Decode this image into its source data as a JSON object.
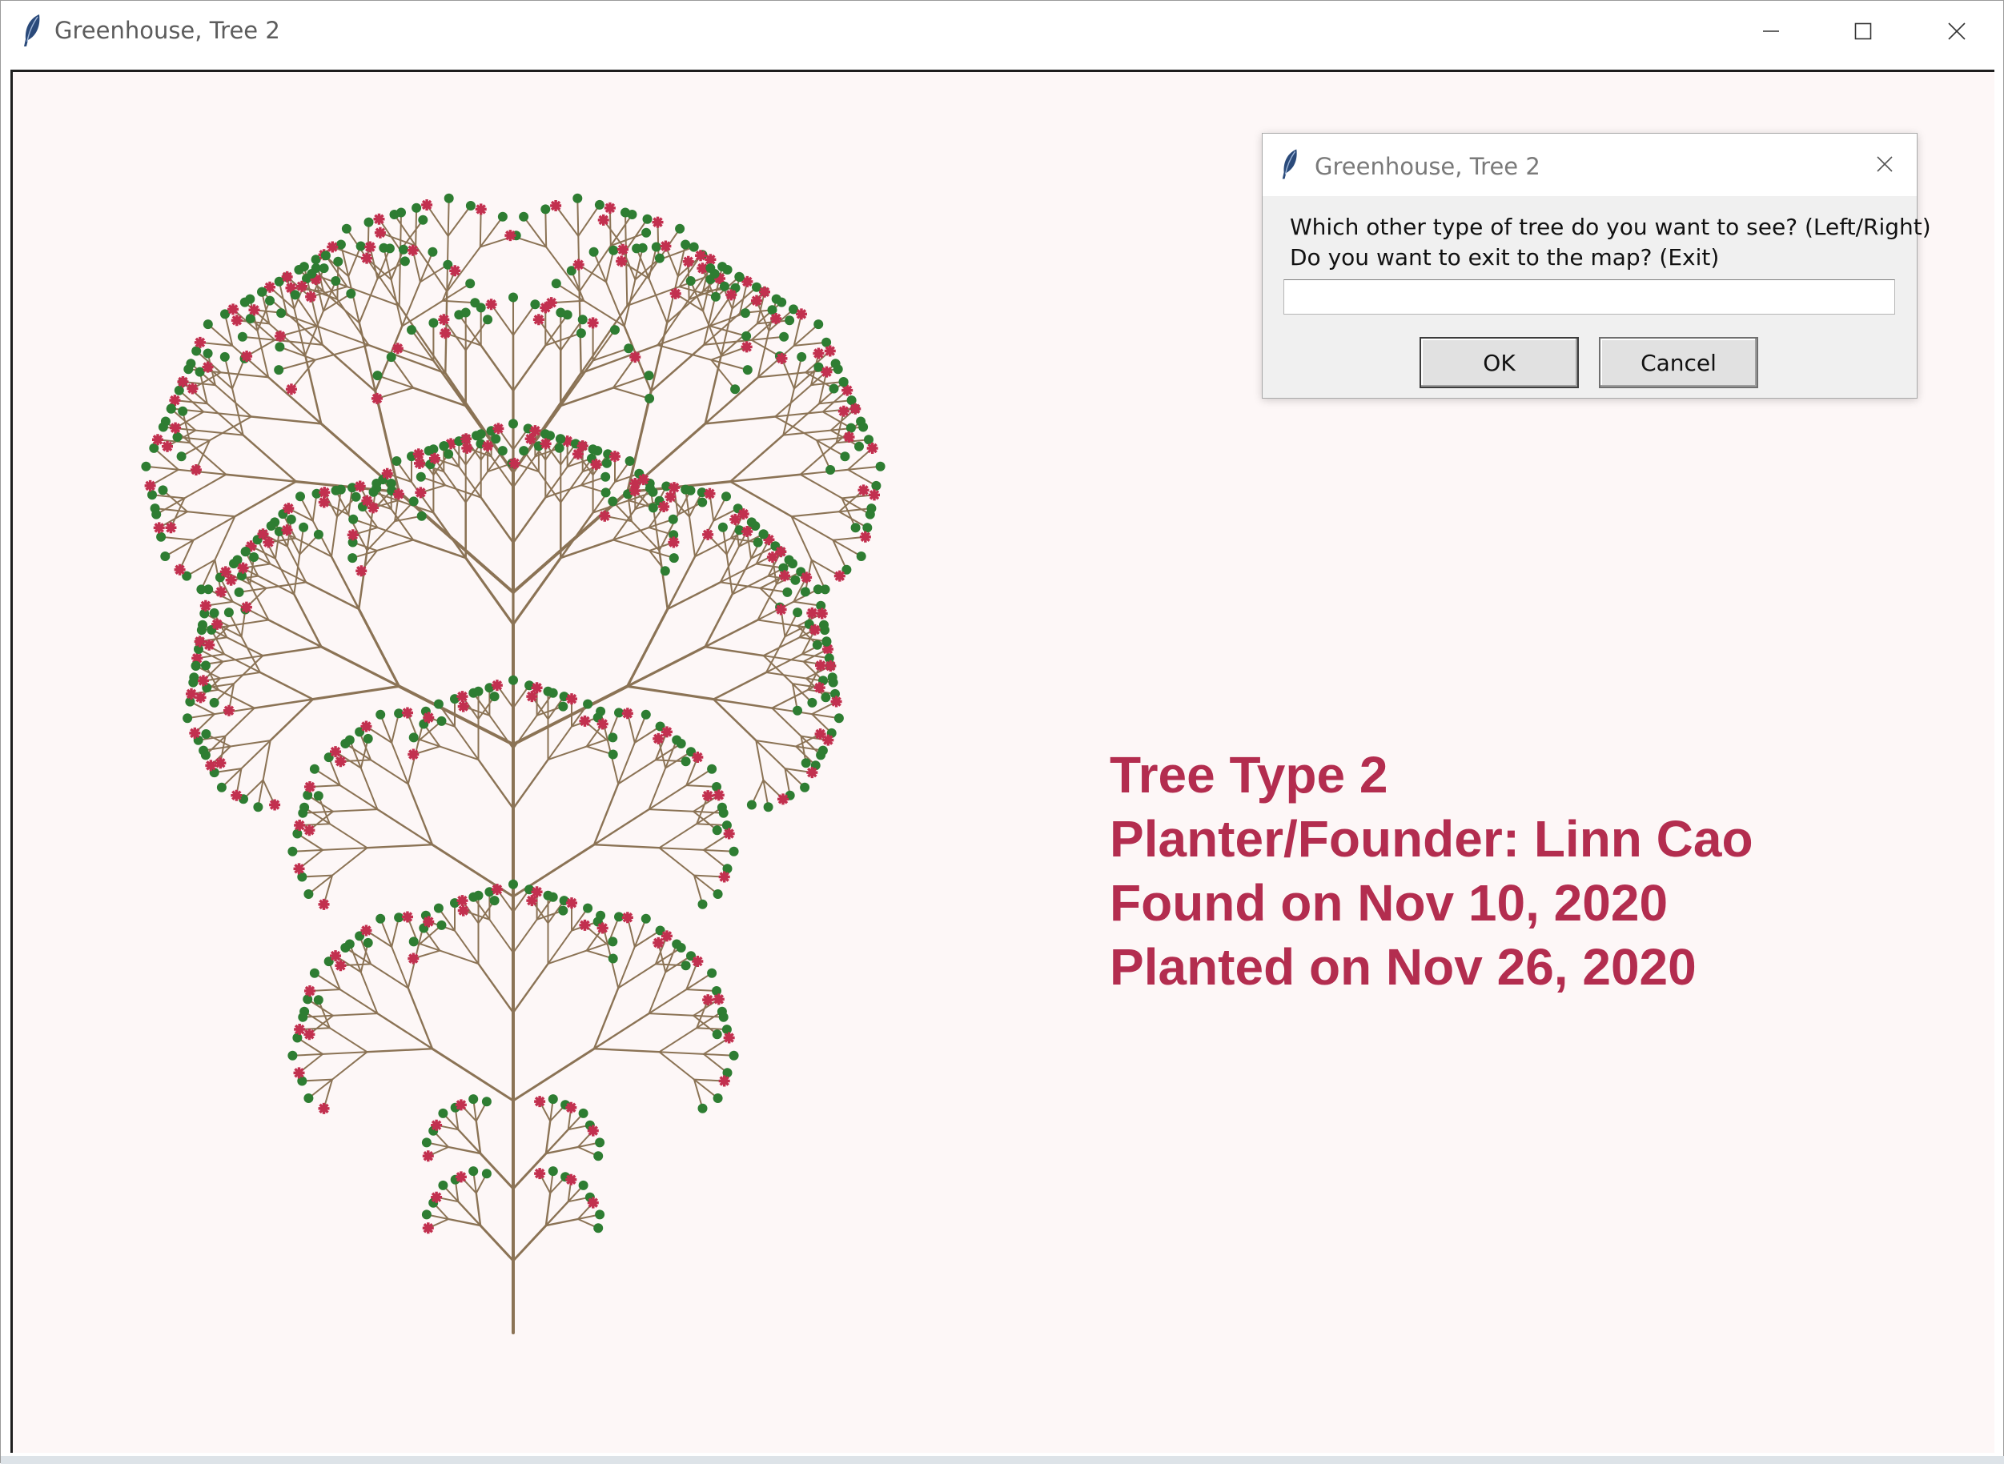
{
  "window": {
    "title": "Greenhouse, Tree 2",
    "icon": "feather-icon",
    "controls": [
      "minimize-icon",
      "maximize-icon",
      "close-icon"
    ]
  },
  "canvas": {
    "background": "#fdf7f7",
    "info_color": "#b32d4f",
    "info_lines": [
      "Tree Type 2",
      "Planter/Founder: Linn Cao",
      "Found on Nov 10, 2020",
      "Planted on Nov 26, 2020"
    ],
    "tree_colors": {
      "branch": "#8b7355",
      "leaf": "#2e7d32",
      "flower": "#c2304f"
    }
  },
  "dialog": {
    "title": "Greenhouse, Tree 2",
    "prompt_line1": "Which other type of tree do you want to see? (Left/Right)",
    "prompt_line2": "Do you want to exit to the map? (Exit)",
    "input_value": "",
    "ok_label": "OK",
    "cancel_label": "Cancel"
  }
}
